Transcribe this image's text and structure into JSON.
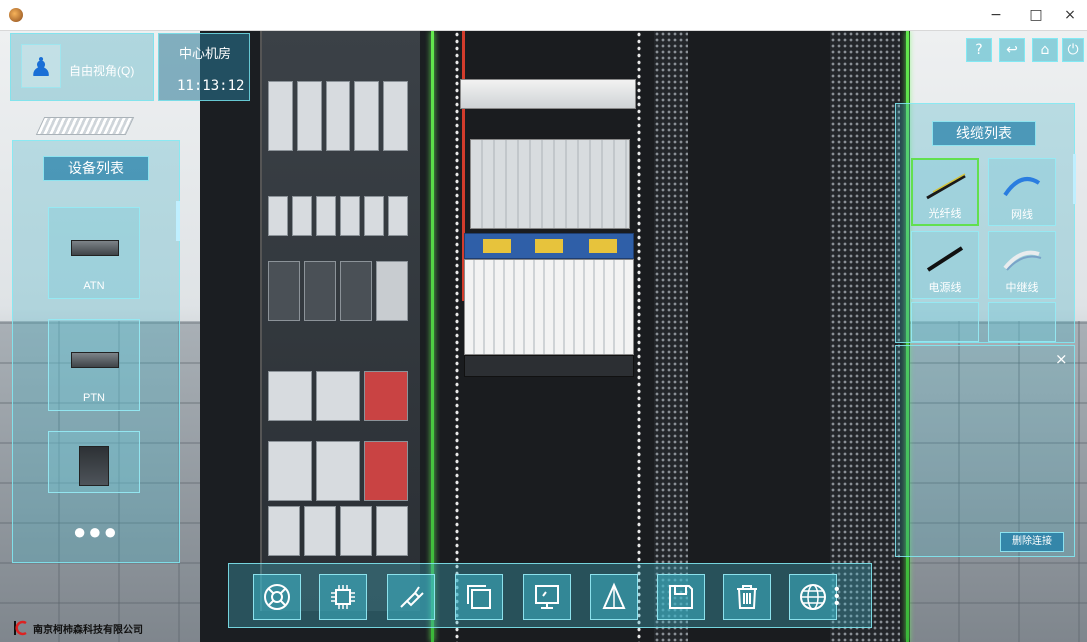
{
  "window": {
    "min": "−",
    "max": "□",
    "close": "×"
  },
  "hud": {
    "mode_label": "自由视角(Q)",
    "room": "中心机房",
    "time": "11:13:12"
  },
  "top_right_buttons": [
    {
      "icon": "help-icon",
      "glyph": "?"
    },
    {
      "icon": "return-icon",
      "glyph": "↩"
    },
    {
      "icon": "home-icon",
      "glyph": "⌂"
    },
    {
      "icon": "power-icon",
      "glyph": "⏻"
    }
  ],
  "device_list": {
    "title": "设备列表",
    "items": [
      "ATN",
      "PTN",
      ""
    ],
    "more": "●●●"
  },
  "cable_list": {
    "title": "线缆列表",
    "items": [
      "光纤线",
      "网线",
      "电源线",
      "中继线"
    ]
  },
  "connection_panel": {
    "delete_label": "删除连接",
    "close": "×"
  },
  "toolbar": [
    {
      "icon": "lifebuoy-icon"
    },
    {
      "icon": "chip-icon"
    },
    {
      "icon": "plug-icon"
    },
    {
      "icon": "copy-icon"
    },
    {
      "icon": "monitor-icon"
    },
    {
      "icon": "triangle-icon"
    },
    {
      "icon": "save-icon"
    },
    {
      "icon": "trash-icon"
    },
    {
      "icon": "globe-icon"
    }
  ],
  "logo_text": "南京柯柿森科技有限公司"
}
